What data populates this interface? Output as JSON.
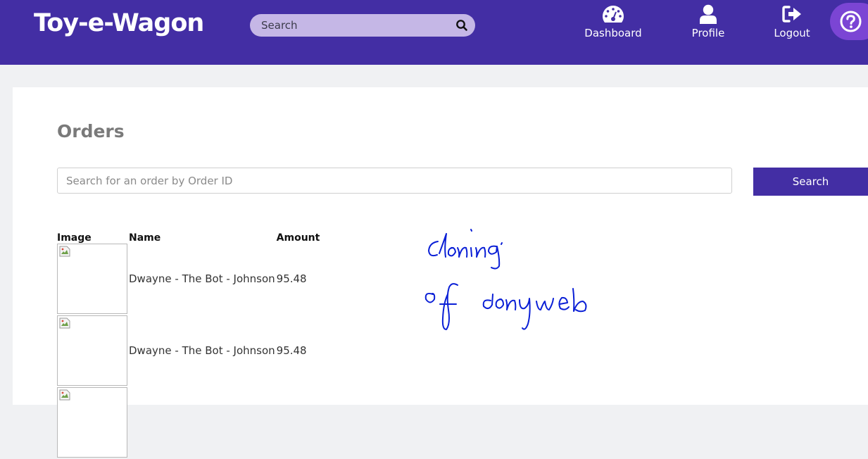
{
  "header": {
    "brand": "Toy-e-Wagon",
    "search_placeholder": "Search",
    "search_icon": "magnifier-icon",
    "nav": {
      "dashboard": "Dashboard",
      "profile": "Profile",
      "logout": "Logout"
    },
    "help_icon": "question-circle-icon"
  },
  "main": {
    "title": "Orders",
    "search_placeholder": "Search for an order by Order ID",
    "search_button": "Search",
    "columns": {
      "image": "Image",
      "name": "Name",
      "amount": "Amount"
    },
    "orders": [
      {
        "name": "Dwayne - The Bot - Johnson",
        "amount": "95.48"
      },
      {
        "name": "Dwayne - The Bot - Johnson",
        "amount": "95.48"
      },
      {
        "name": "",
        "amount": ""
      }
    ]
  },
  "annotation": {
    "line1": "cloning",
    "line2": "of dony web",
    "color": "#0a1fd6"
  },
  "colors": {
    "primary": "#432ea4",
    "search_bg": "#c5b7e6",
    "help_bg": "#7b45d4",
    "page_bg": "#f0f1f3"
  }
}
